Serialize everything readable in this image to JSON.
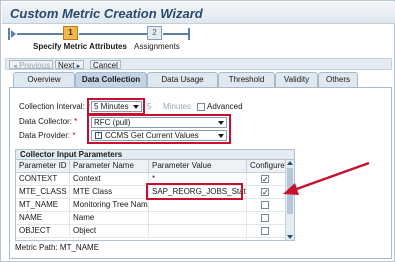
{
  "window": {
    "title": "Custom Metric Creation Wizard"
  },
  "roadmap": {
    "steps": [
      {
        "number": "1",
        "label": "Specify Metric Attributes",
        "active": true
      },
      {
        "number": "2",
        "label": "Assignments",
        "active": false
      }
    ]
  },
  "toolbar": {
    "previous_label": "Previous",
    "next_label": "Next",
    "cancel_label": "Cancel"
  },
  "tabs": [
    {
      "label": "Overview",
      "selected": false
    },
    {
      "label": "Data Collection",
      "selected": true
    },
    {
      "label": "Data Usage",
      "selected": false
    },
    {
      "label": "Threshold",
      "selected": false
    },
    {
      "label": "Validity",
      "selected": false
    },
    {
      "label": "Others",
      "selected": false
    }
  ],
  "form": {
    "collection_interval": {
      "label": "Collection Interval:",
      "value": "5 Minutes",
      "greyed_value": "5",
      "greyed_unit": "Minutes",
      "advanced_label": "Advanced",
      "advanced_checked": false
    },
    "data_collector": {
      "label": "Data Collector:",
      "value": "RFC (pull)"
    },
    "data_provider": {
      "label": "Data Provider:",
      "value": "CCMS Get Current Values",
      "icon": "function-icon"
    },
    "required_marker": "*"
  },
  "collector_table": {
    "title": "Collector Input Parameters",
    "columns": [
      "Parameter ID",
      "Parameter Name",
      "Parameter Value",
      "Configure"
    ],
    "rows": [
      {
        "id": "CONTEXT",
        "name": "Context",
        "value": "*",
        "configure": true
      },
      {
        "id": "MTE_CLASS",
        "name": "MTE Class",
        "value": "SAP_REORG_JOBS_Status",
        "configure": true
      },
      {
        "id": "MT_NAME",
        "name": "Monitoring Tree Name",
        "value": "",
        "configure": false
      },
      {
        "id": "NAME",
        "name": "Name",
        "value": "",
        "configure": false
      },
      {
        "id": "OBJECT",
        "name": "Object",
        "value": "",
        "configure": false
      }
    ]
  },
  "metric_path": {
    "label": "Metric Path:",
    "value": "MT_NAME"
  },
  "colors": {
    "highlight": "#c8102e",
    "active_step": "#f0b84a",
    "tab_selected": "#c3d4e6"
  }
}
